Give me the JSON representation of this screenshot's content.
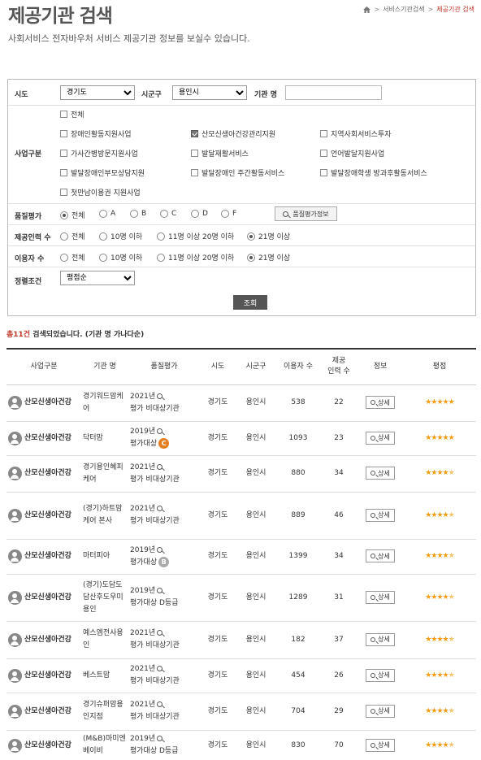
{
  "page": {
    "title": "제공기관 검색",
    "subtitle": "사회서비스 전자바우처 서비스 제공기관 정보를 보실수 있습니다.",
    "breadcrumb": [
      "서비스기관검색",
      "제공기관 검색"
    ]
  },
  "filters": {
    "sido_label": "시도",
    "sido_value": "경기도",
    "sigungu_label": "시군구",
    "sigungu_value": "용인시",
    "org_name_label": "기관 명",
    "org_name_value": "",
    "business_label": "사업구분",
    "business_all": "전체",
    "business_items": [
      {
        "label": "장애인활동지원사업",
        "checked": false
      },
      {
        "label": "산모신생아건강관리지원",
        "checked": true
      },
      {
        "label": "지역사회서비스투자",
        "checked": false
      },
      {
        "label": "가사간병방문지원사업",
        "checked": false
      },
      {
        "label": "발달재활서비스",
        "checked": false
      },
      {
        "label": "언어발달지원사업",
        "checked": false
      },
      {
        "label": "발달장애인부모상담지원",
        "checked": false
      },
      {
        "label": "발달장애인 주간활동서비스",
        "checked": false
      },
      {
        "label": "발달장애학생 방과후활동서비스",
        "checked": false
      },
      {
        "label": "첫만남이용권 지원사업",
        "checked": false
      }
    ],
    "quality_label": "품질평가",
    "quality_options": [
      "전체",
      "A",
      "B",
      "C",
      "D",
      "F"
    ],
    "quality_selected": 0,
    "quality_info_button": "품질평가정보",
    "staff_label": "제공인력 수",
    "staff_options": [
      "전체",
      "10명 이하",
      "11명 이상 20명 이하",
      "21명 이상"
    ],
    "staff_selected": 3,
    "users_label": "이용자 수",
    "users_options": [
      "전체",
      "10명 이하",
      "11명 이상 20명 이하",
      "21명 이상"
    ],
    "users_selected": 3,
    "sort_label": "정렬조건",
    "sort_value": "평점순",
    "search_button": "조회"
  },
  "result": {
    "count_text": "총11건",
    "suffix_text": " 검색되었습니다. (기관 명 가나다순)"
  },
  "table": {
    "headers": [
      "사업구분",
      "기관 명",
      "품질평가",
      "시도",
      "시군구",
      "이용자 수",
      "제공\n인력 수",
      "정보",
      "평점"
    ],
    "detail_label": "상세",
    "rows": [
      {
        "type": "산모신생아건강",
        "name": "경기워드맘케어",
        "year": "2021년",
        "eval": "평가 비대상기관",
        "grade": "",
        "sido": "경기도",
        "sigungu": "용인시",
        "users": "538",
        "staff": "22",
        "rating": 5
      },
      {
        "type": "산모신생아건강",
        "name": "닥터맘",
        "year": "2019년",
        "eval": "평가대상",
        "grade": "C",
        "sido": "경기도",
        "sigungu": "용인시",
        "users": "1093",
        "staff": "23",
        "rating": 5
      },
      {
        "type": "산모신생아건강",
        "name": "경기용인혜피케어",
        "year": "2021년",
        "eval": "평가 비대상기관",
        "grade": "",
        "sido": "경기도",
        "sigungu": "용인시",
        "users": "880",
        "staff": "34",
        "rating": 4.5
      },
      {
        "type": "산모신생아건강",
        "name": "(경기)하트맘케어 본사",
        "year": "2021년",
        "eval": "평가 비대상기관",
        "grade": "",
        "sido": "경기도",
        "sigungu": "용인시",
        "users": "889",
        "staff": "46",
        "rating": 4.5
      },
      {
        "type": "산모신생아건강",
        "name": "마터피아",
        "year": "2019년",
        "eval": "평가대상",
        "grade": "B",
        "sido": "경기도",
        "sigungu": "용인시",
        "users": "1399",
        "staff": "34",
        "rating": 4.5
      },
      {
        "type": "산모신생아건강",
        "name": "(경기)도담도담산후도우미용인",
        "year": "2019년",
        "eval": "평가대상 D등급",
        "grade": "",
        "sido": "경기도",
        "sigungu": "용인시",
        "users": "1289",
        "staff": "31",
        "rating": 4.5
      },
      {
        "type": "산모신생아건강",
        "name": "예스엠전사용인",
        "year": "2021년",
        "eval": "평가 비대상기관",
        "grade": "",
        "sido": "경기도",
        "sigungu": "용인시",
        "users": "182",
        "staff": "37",
        "rating": 4.5
      },
      {
        "type": "산모신생아건강",
        "name": "베스트맘",
        "year": "2021년",
        "eval": "평가 비대상기관",
        "grade": "",
        "sido": "경기도",
        "sigungu": "용인시",
        "users": "454",
        "staff": "26",
        "rating": 4.5
      },
      {
        "type": "산모신생아건강",
        "name": "경기슈퍼맘용인지점",
        "year": "2021년",
        "eval": "평가 비대상기관",
        "grade": "",
        "sido": "경기도",
        "sigungu": "용인시",
        "users": "704",
        "staff": "29",
        "rating": 4.5
      },
      {
        "type": "산모신생아건강",
        "name": "(M&B)마미엔베이비",
        "year": "2019년",
        "eval": "평가대상 D등급",
        "grade": "",
        "sido": "경기도",
        "sigungu": "용인시",
        "users": "830",
        "staff": "70",
        "rating": 4.5
      }
    ]
  },
  "colors": {
    "accent_red": "#c0392b",
    "grade_c": "#e67e22",
    "grade_b": "#aaaaaa",
    "star": "#f39c12"
  }
}
